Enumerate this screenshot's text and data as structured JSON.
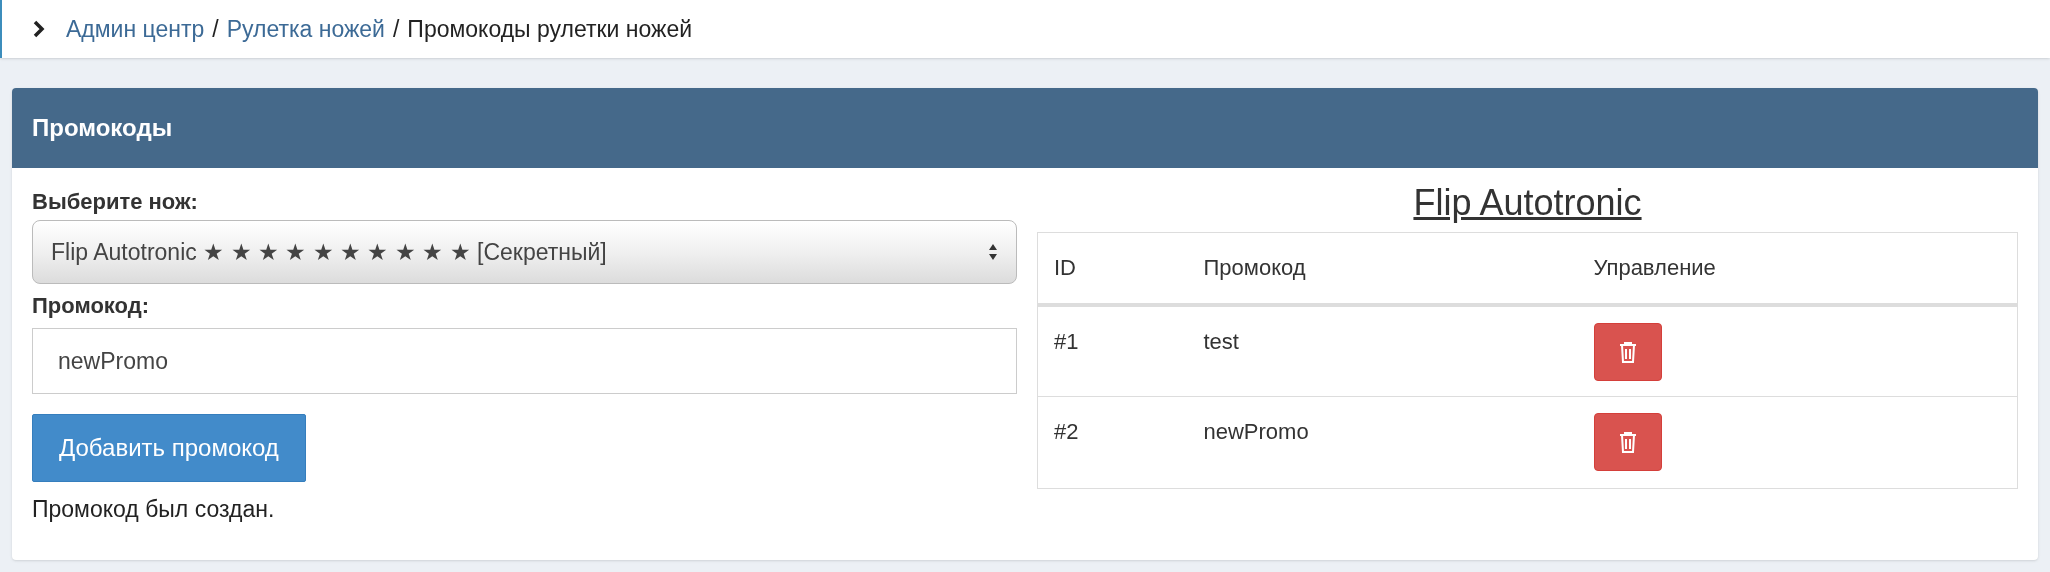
{
  "breadcrumb": [
    {
      "label": "Админ центр",
      "kind": "link"
    },
    {
      "label": "/",
      "kind": "separator"
    },
    {
      "label": "Рулетка ножей",
      "kind": "link"
    },
    {
      "label": "/",
      "kind": "separator"
    },
    {
      "label": "Промокоды рулетки ножей",
      "kind": "current"
    }
  ],
  "panel": {
    "title": "Промокоды"
  },
  "form": {
    "knife_label": "Выберите нож:",
    "knife_value": "Flip Autotronic ★ ★ ★ ★ ★ ★ ★ ★ ★ ★ [Секретный]",
    "promo_label": "Промокод:",
    "promo_value": "newPromo",
    "submit": "Добавить промокод",
    "message": "Промокод был создан."
  },
  "table": {
    "title": "Flip Autotronic",
    "columns": [
      "ID",
      "Промокод",
      "Управление"
    ],
    "rows": [
      {
        "id": "#1",
        "code": "test"
      },
      {
        "id": "#2",
        "code": "newPromo"
      }
    ]
  }
}
